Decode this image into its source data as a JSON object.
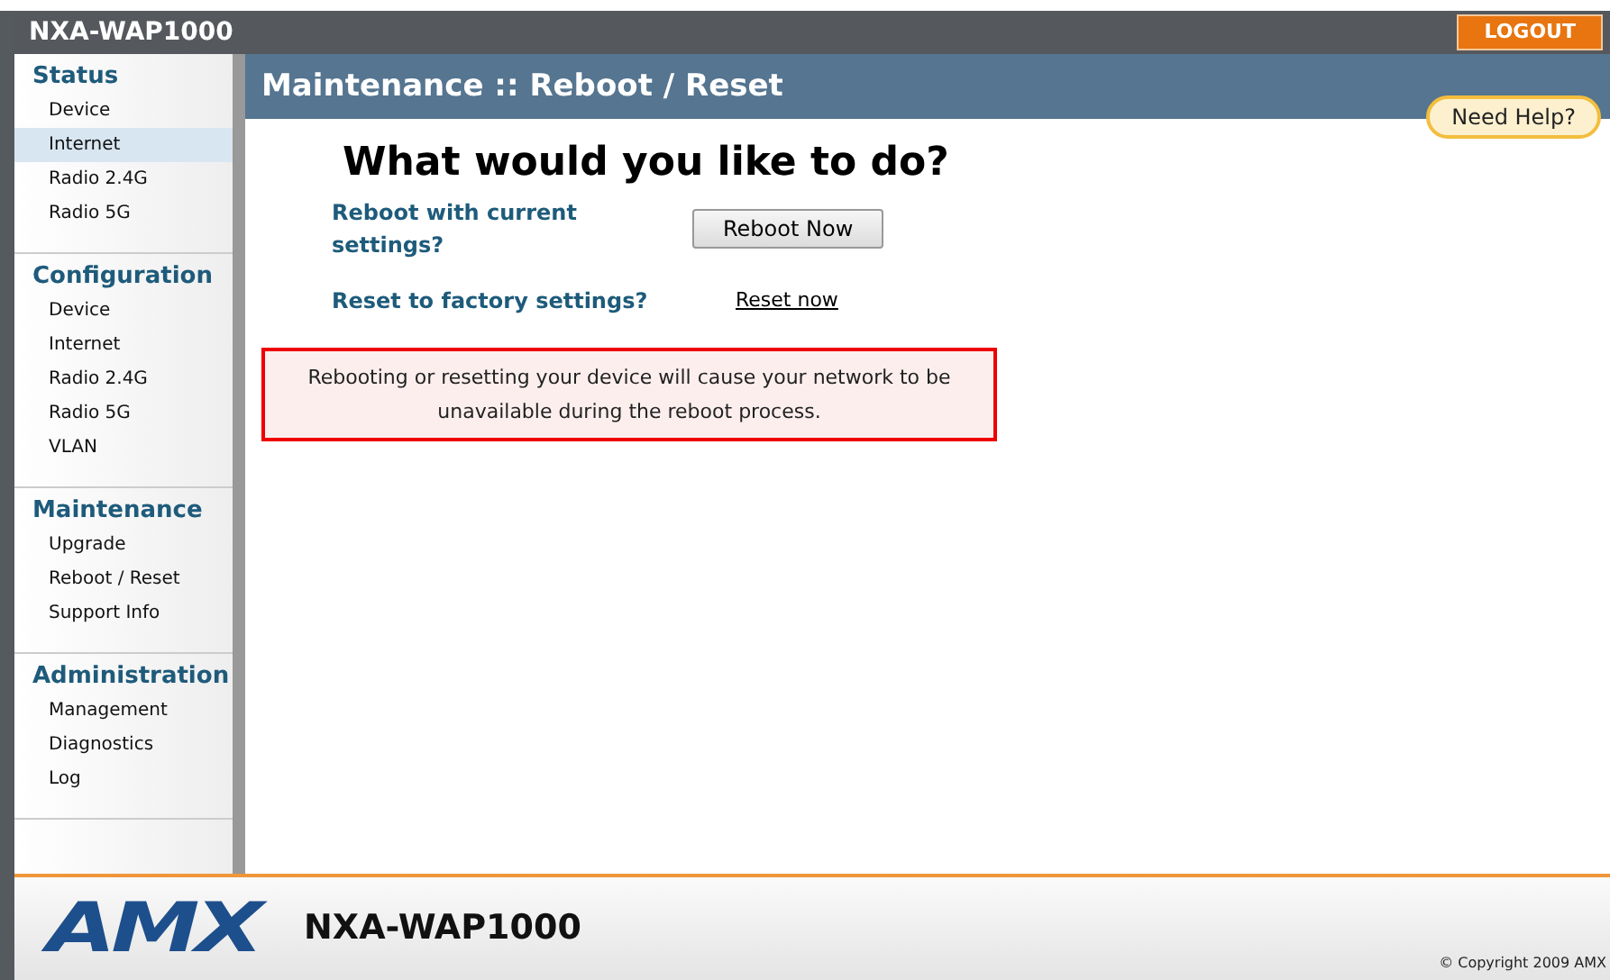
{
  "header": {
    "title": "NXA-WAP1000",
    "logout": "LOGOUT"
  },
  "sidebar": [
    {
      "heading": "Status",
      "items": [
        {
          "label": "Device",
          "selected": false
        },
        {
          "label": "Internet",
          "selected": true
        },
        {
          "label": "Radio 2.4G",
          "selected": false
        },
        {
          "label": "Radio 5G",
          "selected": false
        }
      ]
    },
    {
      "heading": "Configuration",
      "items": [
        {
          "label": "Device",
          "selected": false
        },
        {
          "label": "Internet",
          "selected": false
        },
        {
          "label": "Radio 2.4G",
          "selected": false
        },
        {
          "label": "Radio 5G",
          "selected": false
        },
        {
          "label": "VLAN",
          "selected": false
        }
      ]
    },
    {
      "heading": "Maintenance",
      "items": [
        {
          "label": "Upgrade",
          "selected": false
        },
        {
          "label": "Reboot / Reset",
          "selected": false
        },
        {
          "label": "Support Info",
          "selected": false
        }
      ]
    },
    {
      "heading": "Administration",
      "items": [
        {
          "label": "Management",
          "selected": false
        },
        {
          "label": "Diagnostics",
          "selected": false
        },
        {
          "label": "Log",
          "selected": false
        }
      ]
    }
  ],
  "page": {
    "title": "Maintenance :: Reboot / Reset",
    "help": "Need Help?",
    "question": "What would you like to do?",
    "actions": [
      {
        "kind": "button",
        "label": "Reboot with current settings?",
        "control": "Reboot Now"
      },
      {
        "kind": "link",
        "label": "Reset to factory settings?",
        "control": "Reset now"
      }
    ],
    "warning": "Rebooting or resetting your device will cause your network to be unavailable during the reboot process."
  },
  "footer": {
    "logo": "AMX",
    "model": "NXA-WAP1000",
    "copyright": "© Copyright 2009 AMX"
  }
}
